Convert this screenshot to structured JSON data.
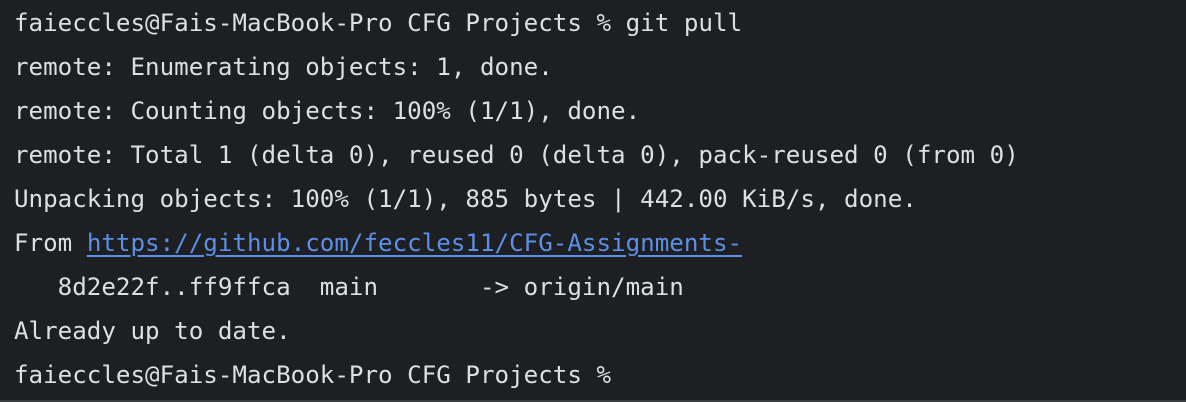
{
  "terminal": {
    "prompt": "faieccles@Fais-MacBook-Pro CFG Projects % ",
    "command": "git pull",
    "lines": [
      "remote: Enumerating objects: 1, done.",
      "remote: Counting objects: 100% (1/1), done.",
      "remote: Total 1 (delta 0), reused 0 (delta 0), pack-reused 0 (from 0)",
      "Unpacking objects: 100% (1/1), 885 bytes | 442.00 KiB/s, done."
    ],
    "from_label": "From ",
    "repo_url": "https://github.com/feccles11/CFG-Assignments-",
    "ref_update": "   8d2e22f..ff9ffca  main       -> origin/main",
    "status": "Already up to date.",
    "final_prompt": "faieccles@Fais-MacBook-Pro CFG Projects %",
    "colors": {
      "background": "#1e1f22",
      "text": "#dcdfe4",
      "link": "#5c8fe6"
    }
  }
}
